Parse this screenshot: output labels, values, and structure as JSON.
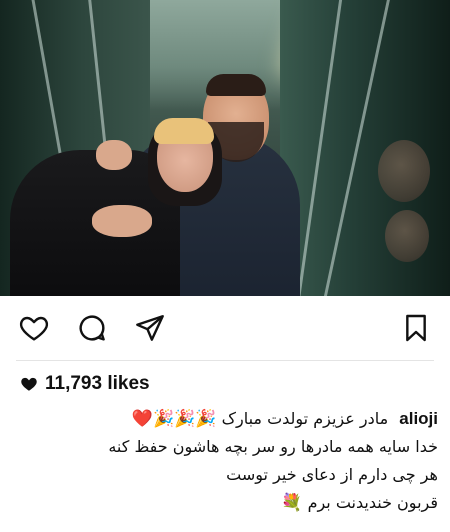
{
  "post": {
    "username": "alioji",
    "likes_label": "11,793 likes",
    "caption_line1_text": "مادر عزیزم تولدت مبارک",
    "caption_line1_emojis": "🎉🎉🎉❤️",
    "caption_line2": "خدا سایه همه مادرها رو سر بچه هاشون حفظ کنه",
    "caption_line3": "هر چی دارم از دعای خیر توست",
    "caption_line4_text": "قربون خندیدنت برم",
    "caption_line4_emoji": "💐"
  },
  "icons": {
    "like": "heart-icon",
    "comment": "comment-icon",
    "share": "send-icon",
    "save": "bookmark-icon",
    "likes_heart": "heart-filled-icon"
  },
  "colors": {
    "text": "#111111",
    "separator": "#e4e4e4",
    "icon": "#111111"
  }
}
